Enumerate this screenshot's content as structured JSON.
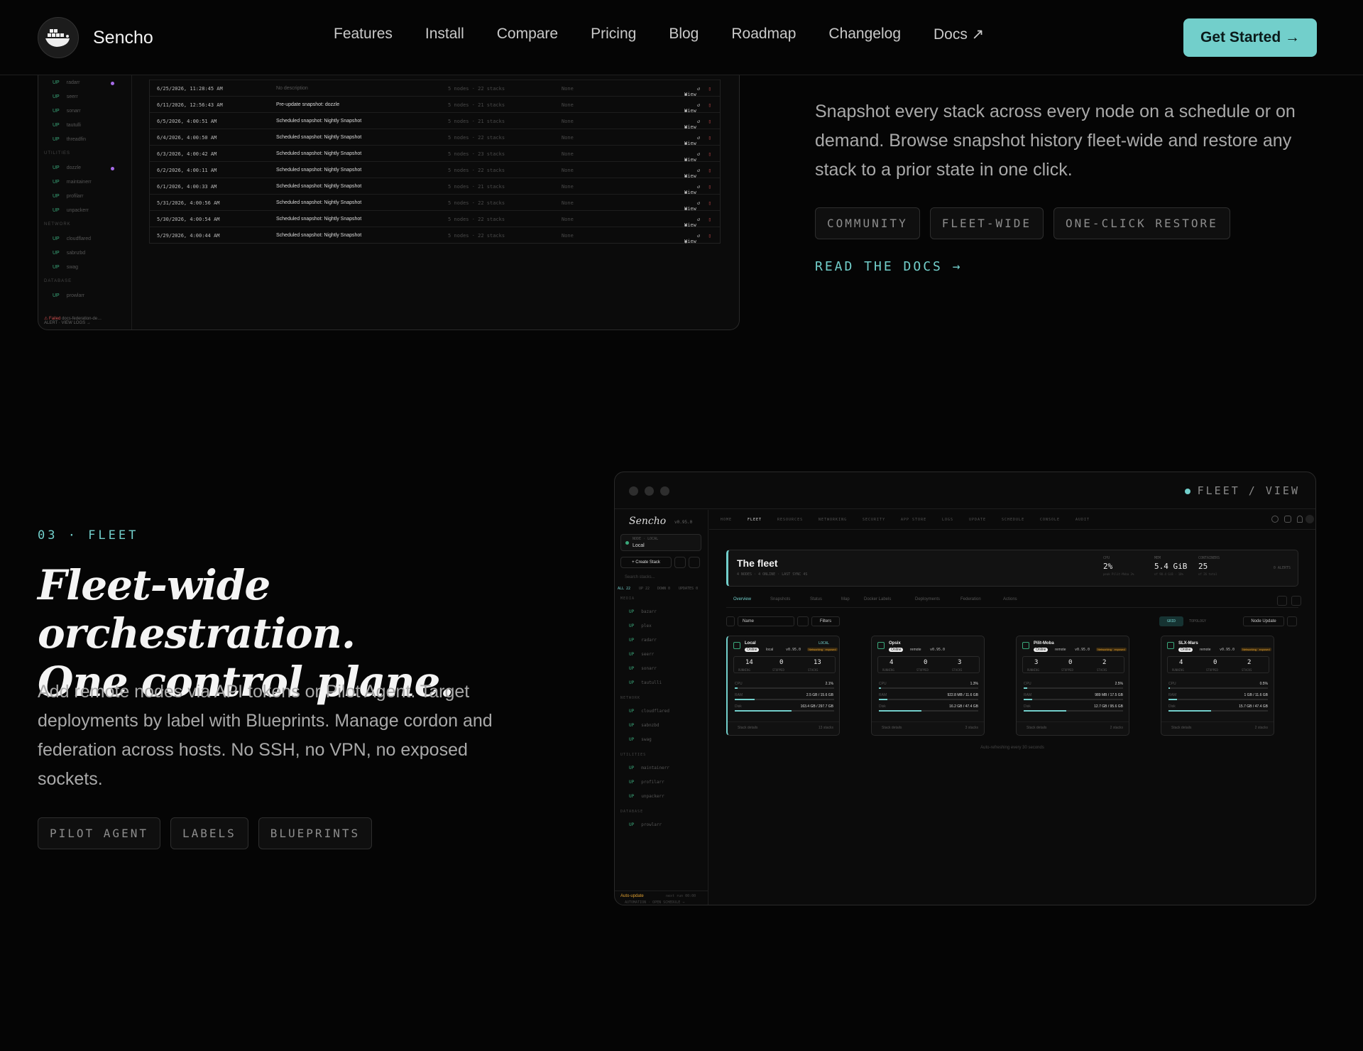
{
  "nav": {
    "brand": "Sencho",
    "links": [
      "Features",
      "Install",
      "Compare",
      "Pricing",
      "Blog",
      "Roadmap",
      "Changelog",
      "Docs ↗"
    ],
    "cta": "Get Started →"
  },
  "snapshots_section": {
    "description": "Snapshot every stack across every node on a schedule or on demand. Browse snapshot history fleet-wide and restore any stack to a prior state in one click.",
    "tags": [
      "COMMUNITY",
      "FLEET-WIDE",
      "ONE-CLICK RESTORE"
    ],
    "docs_link": "READ THE DOCS →",
    "screenshot": {
      "sidebar": {
        "items_top": [
          "radarr",
          "seerr",
          "sonarr",
          "tautulli",
          "threadfin"
        ],
        "utilities_label": "UTILITIES",
        "utilities": [
          "dozzle",
          "maintainerr",
          "profilarr",
          "unpackerr"
        ],
        "network_label": "NETWORK",
        "network": [
          "cloudflared",
          "sabnzbd",
          "swag"
        ],
        "database_label": "DATABASE",
        "database": [
          "prowlarr"
        ],
        "up_label": "UP",
        "footer_status": "⚠ Failed",
        "footer_name": "docs-federation-de…",
        "footer_sub": "ALERT · VIEW LOGS →"
      },
      "rows": [
        {
          "date": "6/25/2026, 11:28:45 AM",
          "desc": "No description",
          "nodes": "5 nodes · 22 stacks",
          "none": "None"
        },
        {
          "date": "6/11/2026, 12:56:43 AM",
          "desc": "Pre-update snapshot: dozzle",
          "nodes": "5 nodes · 21 stacks",
          "none": "None"
        },
        {
          "date": "6/5/2026, 4:00:51 AM",
          "desc": "Scheduled snapshot: Nightly Snapshot",
          "nodes": "5 nodes · 21 stacks",
          "none": "None"
        },
        {
          "date": "6/4/2026, 4:00:50 AM",
          "desc": "Scheduled snapshot: Nightly Snapshot",
          "nodes": "5 nodes · 22 stacks",
          "none": "None"
        },
        {
          "date": "6/3/2026, 4:00:42 AM",
          "desc": "Scheduled snapshot: Nightly Snapshot",
          "nodes": "5 nodes · 23 stacks",
          "none": "None"
        },
        {
          "date": "6/2/2026, 4:00:11 AM",
          "desc": "Scheduled snapshot: Nightly Snapshot",
          "nodes": "5 nodes · 22 stacks",
          "none": "None"
        },
        {
          "date": "6/1/2026, 4:00:33 AM",
          "desc": "Scheduled snapshot: Nightly Snapshot",
          "nodes": "5 nodes · 21 stacks",
          "none": "None"
        },
        {
          "date": "5/31/2026, 4:00:56 AM",
          "desc": "Scheduled snapshot: Nightly Snapshot",
          "nodes": "5 nodes · 22 stacks",
          "none": "None"
        },
        {
          "date": "5/30/2026, 4:00:54 AM",
          "desc": "Scheduled snapshot: Nightly Snapshot",
          "nodes": "5 nodes · 22 stacks",
          "none": "None"
        },
        {
          "date": "5/29/2026, 4:00:44 AM",
          "desc": "Scheduled snapshot: Nightly Snapshot",
          "nodes": "5 nodes · 22 stacks",
          "none": "None"
        }
      ],
      "view_label": "View"
    }
  },
  "fleet_section": {
    "eyebrow": "03 · FLEET",
    "heading_line1": "Fleet-wide orchestration.",
    "heading_line2": "One control plane.",
    "body": "Add remote nodes via API tokens or Pilot Agent. Target deployments by label with Blueprints. Manage cordon and federation across hosts. No SSH, no VPN, no exposed sockets.",
    "tags": [
      "PILOT AGENT",
      "LABELS",
      "BLUEPRINTS"
    ],
    "screenshot": {
      "view_label": "FLEET / VIEW",
      "app_name": "Sencho",
      "version": "v0.95.0",
      "node_label": "NODE · LOCAL",
      "node_value": "Local",
      "create_stack": "+ Create Stack",
      "search_placeholder": "Search stacks...",
      "filters": [
        "ALL 22",
        "UP 22",
        "DOWN 0",
        "UPDATES 0"
      ],
      "sections": [
        {
          "label": "MEDIA",
          "items": [
            "bazarr",
            "plex",
            "radarr",
            "seerr",
            "sonarr",
            "tautulli"
          ]
        },
        {
          "label": "NETWORK",
          "items": [
            "cloudflared",
            "sabnzbd",
            "swag"
          ]
        },
        {
          "label": "UTILITIES",
          "items": [
            "maintainerr",
            "profilarr",
            "unpackerr"
          ]
        },
        {
          "label": "DATABASE",
          "items": [
            "prowlarr"
          ]
        }
      ],
      "footer_status": "Auto-update",
      "footer_sub": "AUTOMATION · OPEN SCHEDULE →",
      "footer_time": "next run 00:00",
      "top_tabs": [
        "HOME",
        "FLEET",
        "RESOURCES",
        "NETWORKING",
        "SECURITY",
        "APP STORE",
        "LOGS",
        "UPDATE",
        "SCHEDULE",
        "CONSOLE",
        "AUDIT"
      ],
      "hero_title": "The fleet",
      "hero_sub": "4 NODES · 4 ONLINE · LAST SYNC 4S",
      "stats": [
        {
          "label": "CPU",
          "value": "2%",
          "sub": "peak Pilit-Moba 3%"
        },
        {
          "label": "MEM",
          "value": "5.4 GiB",
          "sub": "of 90.4 GiB · 18%"
        },
        {
          "label": "CONTAINERS",
          "value": "25",
          "sub": "of 26 total"
        }
      ],
      "alerts": "0 ALERTS",
      "subtabs": [
        "Overview",
        "Snapshots",
        "Status",
        "Map",
        "Docker Labels",
        "Deployments",
        "Federation",
        "Actions"
      ],
      "sort_value": "Name",
      "filters_btn": "Filters",
      "view_grid": "GRID",
      "view_topology": "TOPOLOGY",
      "node_update": "Node Update",
      "nodes": [
        {
          "name": "Local",
          "badge": "Online",
          "type": "local",
          "version": "v0.95.0",
          "exposed": "Networking · exposed",
          "running": "14",
          "stopped": "0",
          "stacks": "13",
          "cpu": "2.1%",
          "ram": "2.5 GB / 15.6 GB",
          "disk": "163.4 GB / 297.7 GB",
          "stacks_count": "13 stacks",
          "tag": "LOCAL"
        },
        {
          "name": "Opsix",
          "badge": "Online",
          "type": "remote",
          "version": "v0.95.0",
          "exposed": "",
          "running": "4",
          "stopped": "0",
          "stacks": "3",
          "cpu": "1.3%",
          "ram": "922.8 MB / 11.6 GB",
          "disk": "16.2 GB / 47.4 GB",
          "stacks_count": "3 stacks",
          "tag": ""
        },
        {
          "name": "Pilit-Moba",
          "badge": "Online",
          "type": "remote",
          "version": "v0.95.0",
          "exposed": "Networking · exposed",
          "running": "3",
          "stopped": "0",
          "stacks": "2",
          "cpu": "2.5%",
          "ram": "989 MB / 17.5 GB",
          "disk": "12.7 GB / 95.6 GB",
          "stacks_count": "2 stacks",
          "tag": ""
        },
        {
          "name": "SLX-Mars",
          "badge": "Online",
          "type": "remote",
          "version": "v0.95.0",
          "exposed": "Networking · exposed",
          "running": "4",
          "stopped": "0",
          "stacks": "2",
          "cpu": "0.5%",
          "ram": "1 GB / 11.6 GB",
          "disk": "15.7 GB / 47.4 GB",
          "stacks_count": "2 stacks",
          "tag": ""
        }
      ],
      "metric_labels": {
        "cpu": "CPU",
        "ram": "RAM",
        "disk": "Disk",
        "running": "RUNNING",
        "stopped": "STOPPED",
        "stacks": "STACKS",
        "details": "Stack details"
      },
      "refresh_note": "Auto-refreshing every 30 seconds"
    }
  },
  "colors": {
    "accent": "#72cfcb",
    "bg": "#050505",
    "danger": "#c0474a"
  }
}
